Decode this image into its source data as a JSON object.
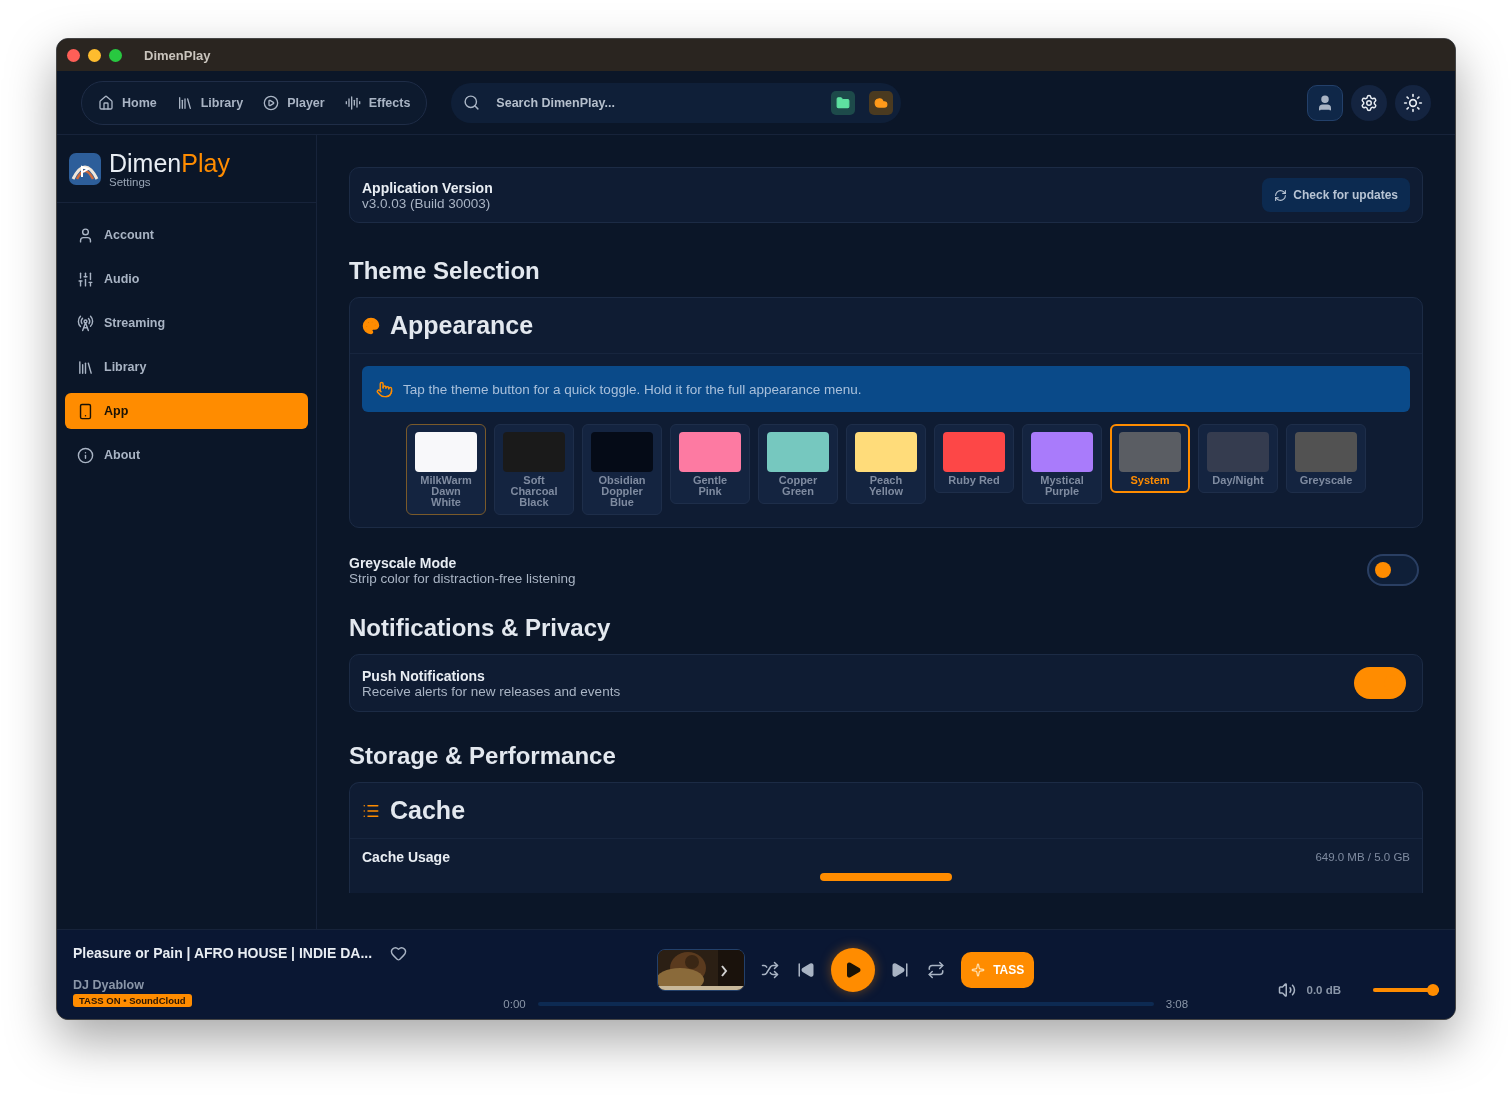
{
  "window": {
    "title": "DimenPlay"
  },
  "nav": {
    "items": [
      {
        "label": "Home"
      },
      {
        "label": "Library"
      },
      {
        "label": "Player"
      },
      {
        "label": "Effects"
      }
    ],
    "search": {
      "placeholder": "Search DimenPlay..."
    }
  },
  "sidebar": {
    "brand": {
      "first": "Dimen",
      "second": "Play",
      "subtitle": "Settings"
    },
    "items": [
      {
        "label": "Account",
        "selected": false
      },
      {
        "label": "Audio",
        "selected": false
      },
      {
        "label": "Streaming",
        "selected": false
      },
      {
        "label": "Library",
        "selected": false
      },
      {
        "label": "App",
        "selected": true
      },
      {
        "label": "About",
        "selected": false
      }
    ]
  },
  "version": {
    "title": "Application Version",
    "value": "v3.0.03 (Build 30003)",
    "button": "Check for updates"
  },
  "theme_section": {
    "heading": "Theme Selection",
    "card_title": "Appearance",
    "hint": "Tap the theme button for a quick toggle. Hold it for the full appearance menu.",
    "themes": [
      {
        "label": "MilkWarm Dawn White",
        "color": "#f8f8fa",
        "selected": false,
        "applied": true
      },
      {
        "label": "Soft Charcoal Black",
        "color": "#1a1a1a",
        "selected": false,
        "applied": false
      },
      {
        "label": "Obsidian Doppler Blue",
        "color": "#050b17",
        "selected": false,
        "applied": false
      },
      {
        "label": "Gentle Pink",
        "color": "#fd7aa2",
        "selected": false,
        "applied": false
      },
      {
        "label": "Copper Green",
        "color": "#76c8bf",
        "selected": false,
        "applied": false
      },
      {
        "label": "Peach Yellow",
        "color": "#ffdc7a",
        "selected": false,
        "applied": false
      },
      {
        "label": "Ruby Red",
        "color": "#fd4747",
        "selected": false,
        "applied": false
      },
      {
        "label": "Mystical Purple",
        "color": "#a97bfb",
        "selected": false,
        "applied": false
      },
      {
        "label": "System",
        "color": "#5a5d63",
        "selected": true,
        "applied": false
      },
      {
        "label": "Day/Night",
        "color": "#353c4f",
        "selected": false,
        "applied": false
      },
      {
        "label": "Greyscale",
        "color": "#525252",
        "selected": false,
        "applied": false
      }
    ],
    "greyscale": {
      "title": "Greyscale Mode",
      "description": "Strip color for distraction-free listening",
      "on": false
    }
  },
  "notifications": {
    "heading": "Notifications & Privacy",
    "push": {
      "title": "Push Notifications",
      "description": "Receive alerts for new releases and events",
      "on": true
    }
  },
  "storage": {
    "heading": "Storage & Performance",
    "card_title": "Cache",
    "usage_label": "Cache Usage",
    "usage_value": "649.0 MB / 5.0 GB"
  },
  "player": {
    "title": "Pleasure or Pain | AFRO HOUSE | INDIE DA...",
    "artist": "DJ Dyablow",
    "badge": "TASS ON • SoundCloud",
    "liked": false,
    "tass": "TASS",
    "elapsed": "0:00",
    "duration": "3:08",
    "volume_reading": "0.0 dB",
    "volume": {
      "level": 1
    }
  }
}
